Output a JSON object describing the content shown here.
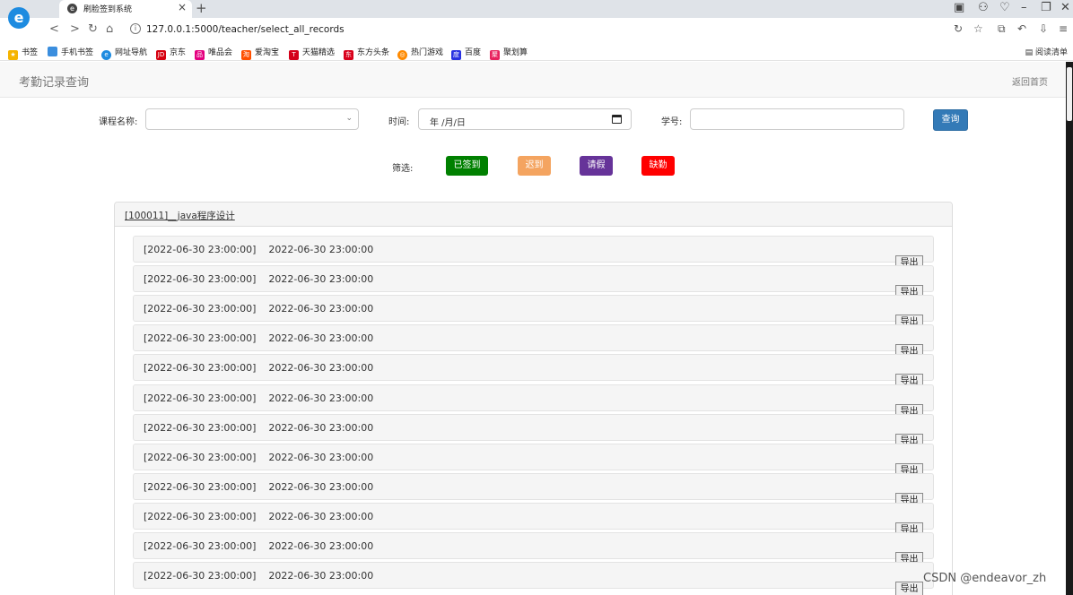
{
  "browser": {
    "tab_title": "刷脸签到系统",
    "url": "127.0.0.1:5000/teacher/select_all_records",
    "bookmarks": [
      "书签",
      "手机书签",
      "网址导航",
      "京东",
      "唯品会",
      "爱淘宝",
      "天猫精选",
      "东方头条",
      "热门游戏",
      "百度",
      "聚划算"
    ],
    "reading_list": "阅读清单"
  },
  "navbar": {
    "brand": "考勤记录查询",
    "back_home": "返回首页"
  },
  "search": {
    "course_label": "课程名称:",
    "time_label": "时间:",
    "date_placeholder": "年 /月/日",
    "student_label": "学号:",
    "query_button": "查询"
  },
  "filter": {
    "label": "筛选:",
    "buttons": [
      {
        "label": "已签到",
        "color": "#008000"
      },
      {
        "label": "迟到",
        "color": "#f4a460"
      },
      {
        "label": "请假",
        "color": "#663399"
      },
      {
        "label": "缺勤",
        "color": "#ff0000"
      }
    ]
  },
  "course": {
    "title": "[100011]__java程序设计"
  },
  "records": [
    {
      "start": "[2022-06-30 23:00:00]",
      "end": "2022-06-30 23:00:00"
    },
    {
      "start": "[2022-06-30 23:00:00]",
      "end": "2022-06-30 23:00:00"
    },
    {
      "start": "[2022-06-30 23:00:00]",
      "end": "2022-06-30 23:00:00"
    },
    {
      "start": "[2022-06-30 23:00:00]",
      "end": "2022-06-30 23:00:00"
    },
    {
      "start": "[2022-06-30 23:00:00]",
      "end": "2022-06-30 23:00:00"
    },
    {
      "start": "[2022-06-30 23:00:00]",
      "end": "2022-06-30 23:00:00"
    },
    {
      "start": "[2022-06-30 23:00:00]",
      "end": "2022-06-30 23:00:00"
    },
    {
      "start": "[2022-06-30 23:00:00]",
      "end": "2022-06-30 23:00:00"
    },
    {
      "start": "[2022-06-30 23:00:00]",
      "end": "2022-06-30 23:00:00"
    },
    {
      "start": "[2022-06-30 23:00:00]",
      "end": "2022-06-30 23:00:00"
    },
    {
      "start": "[2022-06-30 23:00:00]",
      "end": "2022-06-30 23:00:00"
    },
    {
      "start": "[2022-06-30 23:00:00]",
      "end": "2022-06-30 23:00:00"
    }
  ],
  "export_label": "导出",
  "watermark": "CSDN @endeavor_zh"
}
